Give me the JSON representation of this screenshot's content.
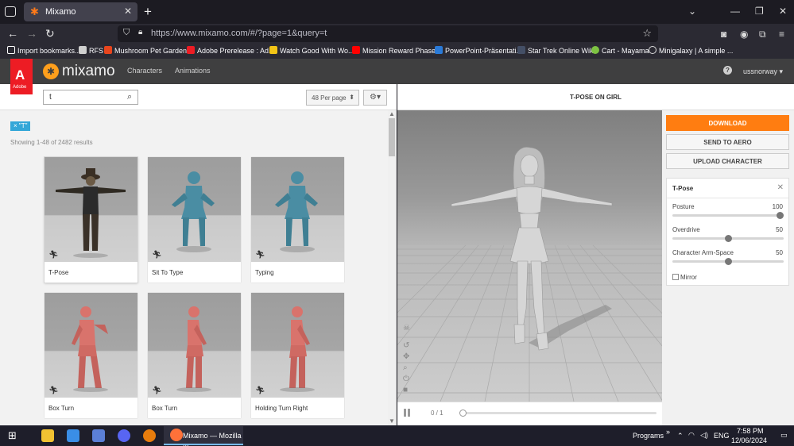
{
  "browser": {
    "tab_title": "Mixamo",
    "url": "https://www.mixamo.com/#/?page=1&query=t"
  },
  "bookmarks": [
    {
      "label": "Import bookmarks...",
      "color": "#ffffff"
    },
    {
      "label": "RFS",
      "color": "#cfcfcf"
    },
    {
      "label": "Mushroom Pet Garden...",
      "color": "#e8451d"
    },
    {
      "label": "Adobe Prerelease : Ad...",
      "color": "#ed1c24"
    },
    {
      "label": "Watch Good With Wo...",
      "color": "#f2c416"
    },
    {
      "label": "Mission Reward Phase...",
      "color": "#ff0000"
    },
    {
      "label": "PowerPoint-Präsentati...",
      "color": "#2a7ad8"
    },
    {
      "label": "Star Trek Online Wiki",
      "color": "#444f66"
    },
    {
      "label": "Cart - Mayama",
      "color": "#7dc242"
    },
    {
      "label": "Minigalaxy | A simple ...",
      "color": "#dddddd"
    }
  ],
  "app": {
    "brand": "mixamo",
    "adobe_label": "Adobe",
    "nav": {
      "characters": "Characters",
      "animations": "Animations"
    },
    "user": "ussnorway"
  },
  "search": {
    "value": "t",
    "per_page": "48 Per page"
  },
  "filter_chip": "× \"T\"",
  "results_text": "Showing 1-48 of 2482 results",
  "cards": [
    {
      "name": "T-Pose",
      "figure": "tpose-man",
      "selected": true
    },
    {
      "name": "Sit To Type",
      "figure": "sit-blue"
    },
    {
      "name": "Typing",
      "figure": "sit-blue"
    },
    {
      "name": "Box Turn",
      "figure": "stand-red"
    },
    {
      "name": "Box Turn",
      "figure": "stand-red-side"
    },
    {
      "name": "Holding Turn Right",
      "figure": "stand-red-side"
    }
  ],
  "viewer": {
    "title": "T-POSE ON GIRL",
    "frames": "0 / 1"
  },
  "actions": {
    "download": "DOWNLOAD",
    "send_to_aero": "SEND TO AERO",
    "upload_character": "UPLOAD CHARACTER"
  },
  "settings": {
    "title": "T-Pose",
    "sliders": [
      {
        "label": "Posture",
        "value": "100",
        "fraction": 1.0
      },
      {
        "label": "Overdrive",
        "value": "50",
        "fraction": 0.5
      },
      {
        "label": "Character Arm-Space",
        "value": "50",
        "fraction": 0.5
      }
    ],
    "mirror_label": "Mirror"
  },
  "taskbar": {
    "firefox_label": "Mixamo — Mozilla ...",
    "programs_label": "Programs",
    "language": "ENG",
    "time": "7:58 PM",
    "date": "12/06/2024"
  },
  "colors": {
    "accent": "#ff7d11",
    "chip": "#34a7d8",
    "adobe_red": "#ed1c24"
  }
}
